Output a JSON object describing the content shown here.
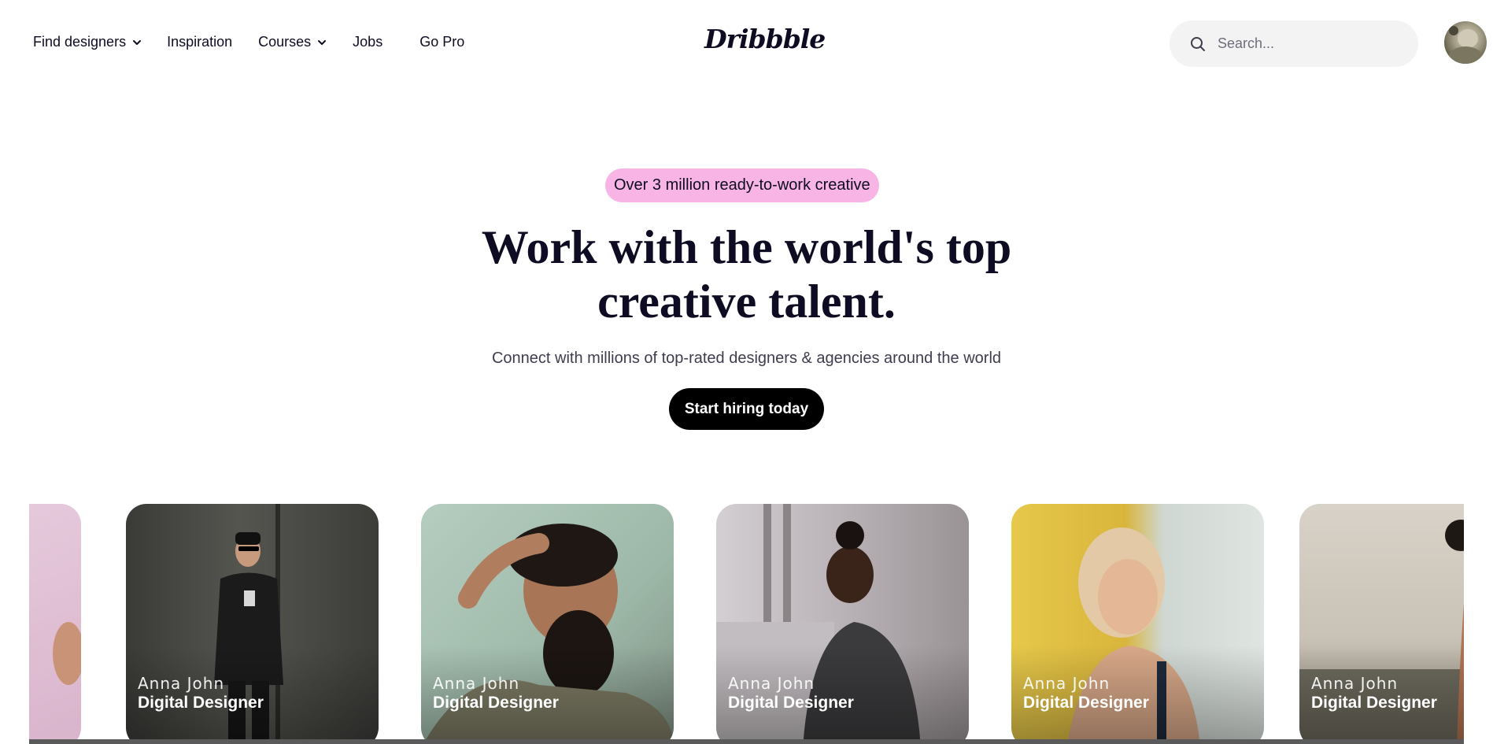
{
  "header": {
    "nav": [
      {
        "label": "Find designers",
        "has_dropdown": true
      },
      {
        "label": "Inspiration",
        "has_dropdown": false
      },
      {
        "label": "Courses",
        "has_dropdown": true
      },
      {
        "label": "Jobs",
        "has_dropdown": false
      },
      {
        "label": "Go Pro",
        "has_dropdown": false
      }
    ],
    "logo": "Dribbble",
    "search": {
      "placeholder": "Search...",
      "value": ""
    }
  },
  "hero": {
    "badge": "Over 3 million ready-to-work creative",
    "headline_line1": "Work with the world's top",
    "headline_line2": "creative talent.",
    "subhead": "Connect with millions of top-rated designers & agencies around the world",
    "cta": "Start hiring today"
  },
  "cards": [
    {
      "name": "Anna John",
      "role": "Digital Designer"
    },
    {
      "name": "Anna John",
      "role": "Digital Designer"
    },
    {
      "name": "Anna John",
      "role": "Digital Designer"
    },
    {
      "name": "Anna John",
      "role": "Digital Designer"
    },
    {
      "name": "Anna John",
      "role": "Digital Designer"
    }
  ],
  "colors": {
    "badge_bg": "#f8b4e5",
    "cta_bg": "#000000",
    "search_bg": "#f3f3f4",
    "text": "#0d0c22"
  }
}
